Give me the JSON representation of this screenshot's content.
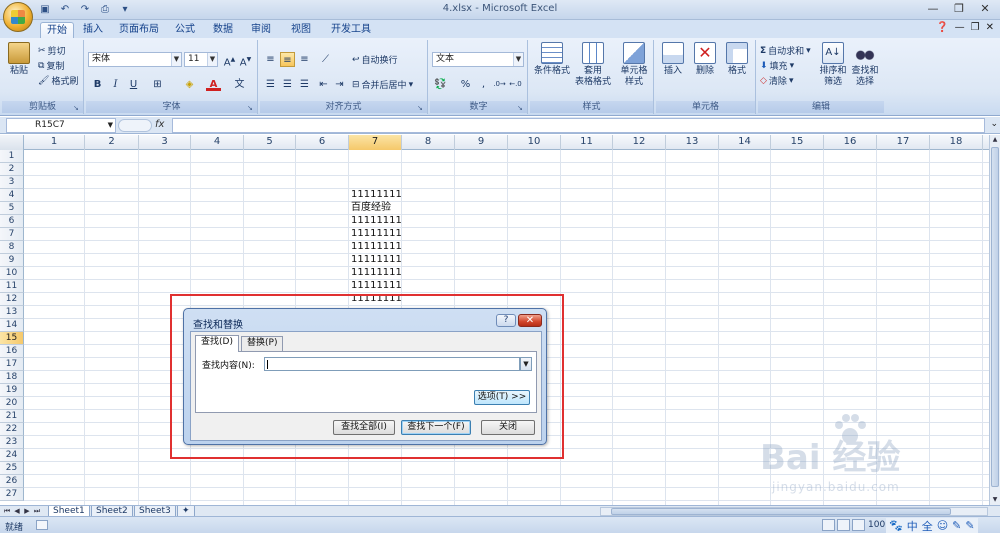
{
  "window": {
    "title": "4.xlsx - Microsoft Excel"
  },
  "qat": {
    "icons": [
      "save-icon",
      "undo-icon",
      "redo-icon",
      "print-preview-icon",
      "customize-icon"
    ]
  },
  "tabs": [
    {
      "label": "开始",
      "active": true
    },
    {
      "label": "插入"
    },
    {
      "label": "页面布局"
    },
    {
      "label": "公式"
    },
    {
      "label": "数据"
    },
    {
      "label": "审阅"
    },
    {
      "label": "视图"
    },
    {
      "label": "开发工具"
    }
  ],
  "ribbon": {
    "clipboard": {
      "label": "剪贴板",
      "paste": "粘贴",
      "cut": "剪切",
      "copy": "复制",
      "format_painter": "格式刷"
    },
    "font": {
      "label": "字体",
      "font_name": "宋体",
      "font_size": "11",
      "bold": "B",
      "italic": "I",
      "underline": "U"
    },
    "alignment": {
      "label": "对齐方式",
      "wrap_text": "自动换行",
      "merge_center": "合并后居中"
    },
    "number": {
      "label": "数字",
      "format": "文本",
      "percent": "%",
      "comma": ","
    },
    "styles": {
      "label": "样式",
      "conditional": "条件格式",
      "table_format_1": "套用",
      "table_format_2": "表格格式",
      "cell_styles_1": "单元格",
      "cell_styles_2": "样式"
    },
    "cells": {
      "label": "单元格",
      "insert": "插入",
      "delete": "删除",
      "format": "格式"
    },
    "editing": {
      "label": "编辑",
      "autosum": "自动求和",
      "fill": "填充",
      "clear": "清除",
      "sort_1": "排序和",
      "sort_2": "筛选",
      "find_1": "查找和",
      "find_2": "选择"
    }
  },
  "formula_bar": {
    "name_box": "R15C7",
    "fx": "fx",
    "content": ""
  },
  "grid": {
    "columns": [
      "1",
      "2",
      "3",
      "4",
      "5",
      "6",
      "7",
      "8",
      "9",
      "10",
      "11",
      "12",
      "13",
      "14",
      "15",
      "16",
      "17",
      "18"
    ],
    "selected_column": "7",
    "rows": [
      "1",
      "2",
      "3",
      "4",
      "5",
      "6",
      "7",
      "8",
      "9",
      "10",
      "11",
      "12",
      "13",
      "14",
      "15",
      "16",
      "17",
      "18",
      "19",
      "20",
      "21",
      "22",
      "23",
      "24",
      "25",
      "26",
      "27"
    ],
    "selected_row": "15",
    "cells": [
      {
        "row": 4,
        "col": 7,
        "value": "11111111"
      },
      {
        "row": 5,
        "col": 7,
        "value": "百度经验"
      },
      {
        "row": 6,
        "col": 7,
        "value": "11111111"
      },
      {
        "row": 7,
        "col": 7,
        "value": "11111111"
      },
      {
        "row": 8,
        "col": 7,
        "value": "11111111"
      },
      {
        "row": 9,
        "col": 7,
        "value": "11111111"
      },
      {
        "row": 10,
        "col": 7,
        "value": "11111111"
      },
      {
        "row": 11,
        "col": 7,
        "value": "11111111"
      },
      {
        "row": 12,
        "col": 7,
        "value": "11111111"
      }
    ]
  },
  "sheets": [
    {
      "label": "Sheet1",
      "active": true
    },
    {
      "label": "Sheet2"
    },
    {
      "label": "Sheet3"
    }
  ],
  "status": {
    "text": "就绪",
    "zoom": "100"
  },
  "ime": [
    "中",
    "全",
    "☺",
    "✎",
    "✎"
  ],
  "dialog": {
    "title": "查找和替换",
    "help": "?",
    "close": "✕",
    "tabs": [
      {
        "label": "查找(D)",
        "active": true
      },
      {
        "label": "替换(P)"
      }
    ],
    "find_label": "查找内容(N):",
    "find_value": "",
    "options_button": "选项(T) >>",
    "find_all_button": "查找全部(I)",
    "find_next_button": "查找下一个(F)",
    "close_button": "关闭"
  },
  "watermark": {
    "logo": "Bai 经验",
    "sub": "jingyan.baidu.com"
  }
}
